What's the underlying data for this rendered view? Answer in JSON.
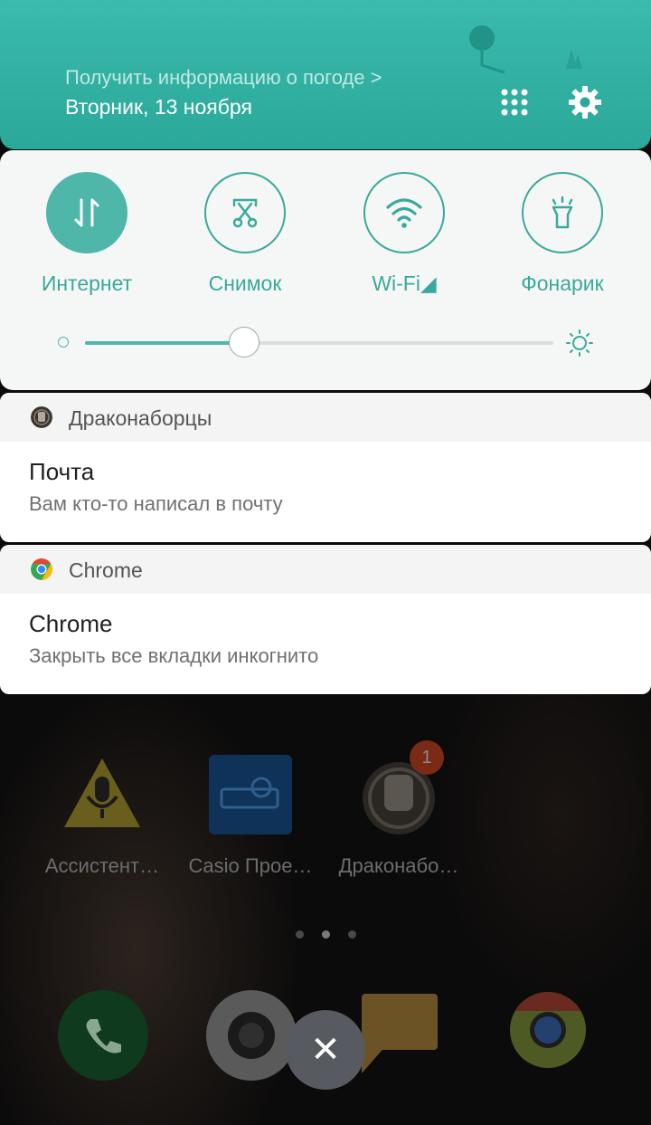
{
  "header": {
    "weather_link": "Получить информацию о погоде >",
    "date": "Вторник, 13 ноября",
    "apps_grid_icon": "grid-icon",
    "settings_icon": "gear-icon"
  },
  "quick_settings": {
    "tiles": [
      {
        "label": "Интернет",
        "icon": "mobile-data-icon",
        "active": true
      },
      {
        "label": "Снимок",
        "icon": "screenshot-scissors-icon",
        "active": false
      },
      {
        "label": "Wi-Fi◢",
        "icon": "wifi-icon",
        "active": false
      },
      {
        "label": "Фонарик",
        "icon": "flashlight-icon",
        "active": false
      }
    ],
    "brightness_percent": 34
  },
  "notifications": [
    {
      "app": "Драконаборцы",
      "title": "Почта",
      "text": "Вам кто-то написал в почту"
    },
    {
      "app": "Chrome",
      "title": "Chrome",
      "text": "Закрыть все вкладки инкогнито"
    }
  ],
  "home": {
    "apps": [
      {
        "label": "Ассистент…",
        "icon": "assistant-icon"
      },
      {
        "label": "Casio Прое…",
        "icon": "projector-icon"
      },
      {
        "label": "Драконабо…",
        "icon": "game-fist-icon",
        "badge": "1"
      }
    ],
    "page_dots": 3,
    "dock": [
      "phone-icon",
      "camera-icon",
      "messages-icon",
      "chrome-icon"
    ],
    "dismiss_all_icon": "close-icon"
  },
  "colors": {
    "accent": "#3aa99b",
    "header": "#2aa89a"
  }
}
